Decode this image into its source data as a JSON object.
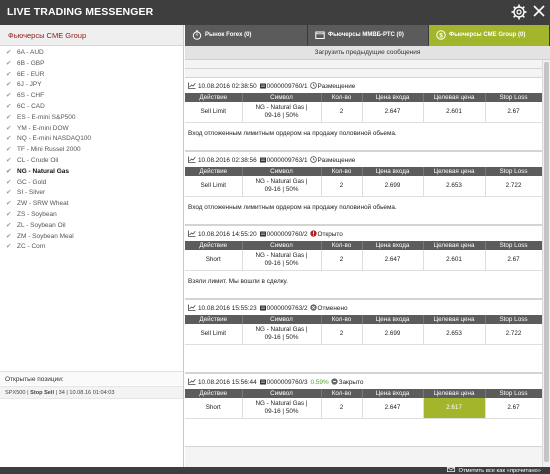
{
  "app": {
    "title": "LIVE TRADING MESSENGER"
  },
  "left": {
    "header": "Фьючерсы CME Group",
    "instruments": [
      {
        "label": "6A - AUD",
        "active": false
      },
      {
        "label": "6B - GBP",
        "active": false
      },
      {
        "label": "6E - EUR",
        "active": false
      },
      {
        "label": "6J - JPY",
        "active": false
      },
      {
        "label": "6S - CHF",
        "active": false
      },
      {
        "label": "6C - CAD",
        "active": false
      },
      {
        "label": "ES - E-mini S&P500",
        "active": false
      },
      {
        "label": "YM - E-mini DOW",
        "active": false
      },
      {
        "label": "NQ - E-mini NASDAQ100",
        "active": false
      },
      {
        "label": "TF - Mini Russel 2000",
        "active": false
      },
      {
        "label": "CL - Crude Oil",
        "active": false
      },
      {
        "label": "NG - Natural Gas",
        "active": true
      },
      {
        "label": "GC - Gold",
        "active": false
      },
      {
        "label": "SI - Silver",
        "active": false
      },
      {
        "label": "ZW - SRW Wheat",
        "active": false
      },
      {
        "label": "ZS - Soybean",
        "active": false
      },
      {
        "label": "ZL - Soybean Oil",
        "active": false
      },
      {
        "label": "ZM - Soybean Meal",
        "active": false
      },
      {
        "label": "ZC - Corn",
        "active": false
      }
    ],
    "positions_title": "Открытые позиции:",
    "positions": [
      {
        "symbol": "SPX500",
        "type": "Stop Sell",
        "qty": "34",
        "time": "10.08.16 01:04:03"
      }
    ]
  },
  "tabs": [
    {
      "label": "Рынок Forex (0)",
      "icon": "stopwatch-icon",
      "active": false
    },
    {
      "label": "Фьючерсы ММВБ-РТС (0)",
      "icon": "folder-icon",
      "active": false
    },
    {
      "label": "Фьючерсы CME Group (0)",
      "icon": "dollar-circle-icon",
      "active": true
    }
  ],
  "load_previous": "Загрузить предыдущие сообщения",
  "columns": [
    "Действие",
    "Символ",
    "Кол-во",
    "Цена входа",
    "Целевая цена",
    "Stop Loss"
  ],
  "messages": [
    {
      "datetime": "10.08.2016 02:38:50",
      "ticket": "0000009760/1",
      "pct": "",
      "status": "Размещение",
      "status_icon": "clock-icon",
      "row": {
        "action": "Sell Limit",
        "symbol_line1": "NG - Natural Gas |",
        "symbol_line2": "09-16 | 50%",
        "qty": "2",
        "entry": "2.647",
        "target": "2.601",
        "stop": "2.67"
      },
      "target_highlight": false,
      "note": "Вход отложенным лимитным ордером на продажу половиной обьема."
    },
    {
      "datetime": "10.08.2016 02:38:56",
      "ticket": "0000009763/1",
      "pct": "",
      "status": "Размещение",
      "status_icon": "clock-icon",
      "row": {
        "action": "Sell Limit",
        "symbol_line1": "NG - Natural Gas |",
        "symbol_line2": "09-16 | 50%",
        "qty": "2",
        "entry": "2.699",
        "target": "2.653",
        "stop": "2.722"
      },
      "target_highlight": false,
      "note": "Вход отложенным лимитным ордером на продажу половиной обьема."
    },
    {
      "datetime": "10.08.2016 14:55:20",
      "ticket": "0000009760/2",
      "pct": "",
      "status": "Открыто",
      "status_icon": "alert-icon",
      "row": {
        "action": "Short",
        "symbol_line1": "NG - Natural Gas |",
        "symbol_line2": "09-16 | 50%",
        "qty": "2",
        "entry": "2.647",
        "target": "2.601",
        "stop": "2.67"
      },
      "target_highlight": false,
      "note": "Взяли лимит. Мы вошли в сделку."
    },
    {
      "datetime": "10.08.2016 15:55:23",
      "ticket": "0000009763/2",
      "pct": "",
      "status": "Отменено",
      "status_icon": "cancel-icon",
      "row": {
        "action": "Sell Limit",
        "symbol_line1": "NG - Natural Gas |",
        "symbol_line2": "09-16 | 50%",
        "qty": "2",
        "entry": "2.699",
        "target": "2.653",
        "stop": "2.722"
      },
      "target_highlight": false,
      "note": ""
    },
    {
      "datetime": "10.08.2016 15:56:44",
      "ticket": "0000009760/3",
      "pct": "0.59%",
      "status": "Закрыто",
      "status_icon": "closed-icon",
      "row": {
        "action": "Short",
        "symbol_line1": "NG - Natural Gas |",
        "symbol_line2": "09-16 | 50%",
        "qty": "2",
        "entry": "2.647",
        "target": "2.617",
        "stop": "2.67"
      },
      "target_highlight": true,
      "note": ""
    }
  ],
  "footer": {
    "mark_all_read": "Отметить все как «прочитано»"
  },
  "colors": {
    "accent": "#a3b52a",
    "titlebar": "#3e3e3e",
    "tabbar": "#5b5b5b",
    "table_header": "#5c5c5c",
    "left_header_text": "#8b1a1a",
    "pct_text": "#4aa52e"
  }
}
